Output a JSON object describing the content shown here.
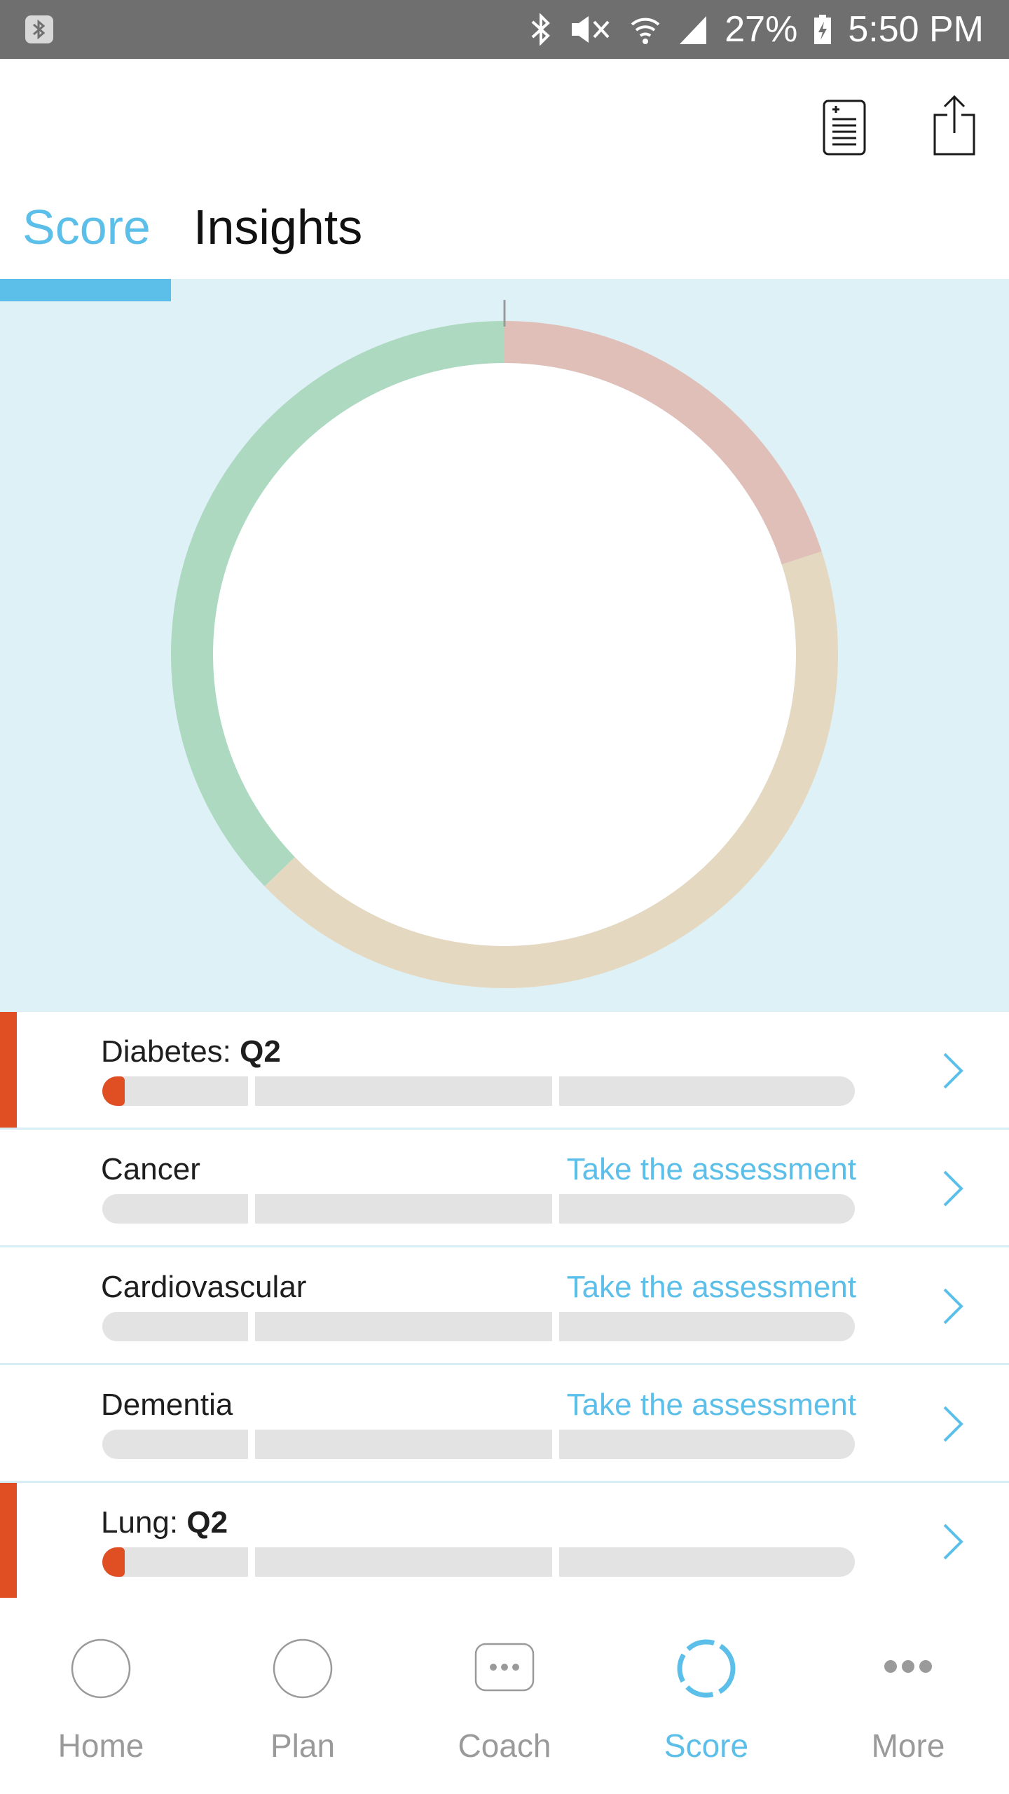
{
  "status_bar": {
    "battery": "27%",
    "time": "5:50 PM"
  },
  "tabs": [
    {
      "label": "Score",
      "active": true
    },
    {
      "label": "Insights",
      "active": false
    }
  ],
  "chart": {
    "segments": [
      {
        "name": "red",
        "color": "#e0bfb9",
        "start_deg": 0,
        "end_deg": 72
      },
      {
        "name": "tan",
        "color": "#e5d8c0",
        "start_deg": 72,
        "end_deg": 226
      },
      {
        "name": "green",
        "color": "#add9c0",
        "start_deg": 226,
        "end_deg": 360
      }
    ]
  },
  "risks": [
    {
      "name": "Diabetes: ",
      "quintile": "Q2",
      "assess": "",
      "flagged": true,
      "fill": 0.03
    },
    {
      "name": "Cancer",
      "quintile": "",
      "assess": "Take the assessment",
      "flagged": false,
      "fill": 0
    },
    {
      "name": "Cardiovascular",
      "quintile": "",
      "assess": "Take the assessment",
      "flagged": false,
      "fill": 0
    },
    {
      "name": "Dementia",
      "quintile": "",
      "assess": "Take the assessment",
      "flagged": false,
      "fill": 0
    },
    {
      "name": "Lung: ",
      "quintile": "Q2",
      "assess": "",
      "flagged": true,
      "fill": 0.03
    }
  ],
  "bottom_nav": [
    {
      "label": "Home",
      "icon": "home-icon",
      "active": false
    },
    {
      "label": "Plan",
      "icon": "plan-icon",
      "active": false
    },
    {
      "label": "Coach",
      "icon": "coach-icon",
      "active": false
    },
    {
      "label": "Score",
      "icon": "score-icon",
      "active": true
    },
    {
      "label": "More",
      "icon": "more-icon",
      "active": false
    }
  ],
  "colors": {
    "accent": "#5bbfe9",
    "flag": "#e04e24",
    "chart_bg": "#def1f7"
  }
}
